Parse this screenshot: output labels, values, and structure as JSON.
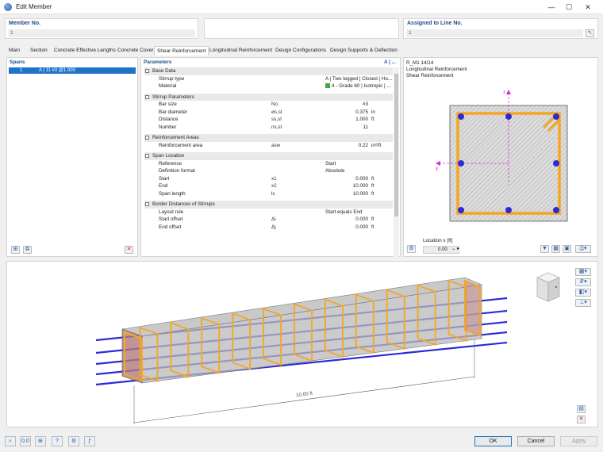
{
  "window": {
    "title": "Edit Member",
    "minimize": "—",
    "maximize": "☐",
    "close": "✕"
  },
  "member_no": {
    "label": "Member No.",
    "value": "1"
  },
  "assigned_line": {
    "label": "Assigned to Line No.",
    "value": "1"
  },
  "tabs": [
    "Main",
    "Section",
    "Concrete Effective Lengths",
    "Concrete Cover",
    "Shear Reinforcement",
    "Longitudinal Reinforcement",
    "Design Configurations",
    "Design Supports & Deflection"
  ],
  "active_tab": "Shear Reinforcement",
  "spans": {
    "title": "Spans",
    "row_num": "1",
    "row_label": "A | 11 #3 @1.000"
  },
  "parameters": {
    "title": "Parameters",
    "title_right": "A | ...",
    "rows": [
      {
        "kind": "section",
        "label": "Base Data"
      },
      {
        "kind": "row",
        "label": "Stirrup type",
        "sym": "",
        "val": "A | Two legged | Closed | Ho...",
        "unit": "",
        "align": "left"
      },
      {
        "kind": "row",
        "label": "Material",
        "sym": "",
        "val": "4 - Grade 60 | Isotropic | ...",
        "unit": "",
        "align": "left",
        "swatch": "#3fa83f"
      },
      {
        "kind": "gap"
      },
      {
        "kind": "section",
        "label": "Stirrup Parameters"
      },
      {
        "kind": "row",
        "label": "Bar size",
        "sym": "No.",
        "val": "#3",
        "unit": ""
      },
      {
        "kind": "row",
        "label": "Bar diameter",
        "sym": "⌀s,st",
        "val": "0.375",
        "unit": "in"
      },
      {
        "kind": "row",
        "label": "Distance",
        "sym": "ss,st",
        "val": "1.000",
        "unit": "ft"
      },
      {
        "kind": "row",
        "label": "Number",
        "sym": "ns,st",
        "val": "11",
        "unit": ""
      },
      {
        "kind": "gap"
      },
      {
        "kind": "section",
        "label": "Reinforcement Areas"
      },
      {
        "kind": "row",
        "label": "Reinforcement area",
        "sym": "asw",
        "val": "0.22",
        "unit": "in²/ft"
      },
      {
        "kind": "gap"
      },
      {
        "kind": "section",
        "label": "Span Location"
      },
      {
        "kind": "row",
        "label": "Reference",
        "sym": "",
        "val": "Start",
        "unit": "",
        "align": "left"
      },
      {
        "kind": "row",
        "label": "Definition format",
        "sym": "",
        "val": "Absolute",
        "unit": "",
        "align": "left"
      },
      {
        "kind": "row",
        "label": "Start",
        "sym": "x1",
        "val": "0.000",
        "unit": "ft"
      },
      {
        "kind": "row",
        "label": "End",
        "sym": "x2",
        "val": "10.000",
        "unit": "ft"
      },
      {
        "kind": "row",
        "label": "Span length",
        "sym": "ls",
        "val": "10.000",
        "unit": "ft"
      },
      {
        "kind": "gap"
      },
      {
        "kind": "section",
        "label": "Border Distances of Stirrups"
      },
      {
        "kind": "row",
        "label": "Layout rule",
        "sym": "",
        "val": "Start equals End",
        "unit": "",
        "align": "left"
      },
      {
        "kind": "row",
        "label": "Start offset",
        "sym": "Δi",
        "val": "0.000",
        "unit": "ft"
      },
      {
        "kind": "row",
        "label": "End offset",
        "sym": "Δj",
        "val": "0.000",
        "unit": "ft"
      }
    ]
  },
  "section_view": {
    "line1": "R_M1 14/14",
    "line2": "Longitudinal Reinforcement",
    "line3": "Shear Reinforcement",
    "axis_z": "z",
    "axis_y": "y",
    "location_label": "Location x [ft]",
    "location_value": "0.00"
  },
  "view3d": {
    "dimension_label": "10.00 ft"
  },
  "buttons": {
    "ok": "OK",
    "cancel": "Cancel",
    "apply": "Apply"
  },
  "colors": {
    "accent": "#1f74c9",
    "stirrup": "#f5a623",
    "rebar": "#2b2bd6"
  }
}
